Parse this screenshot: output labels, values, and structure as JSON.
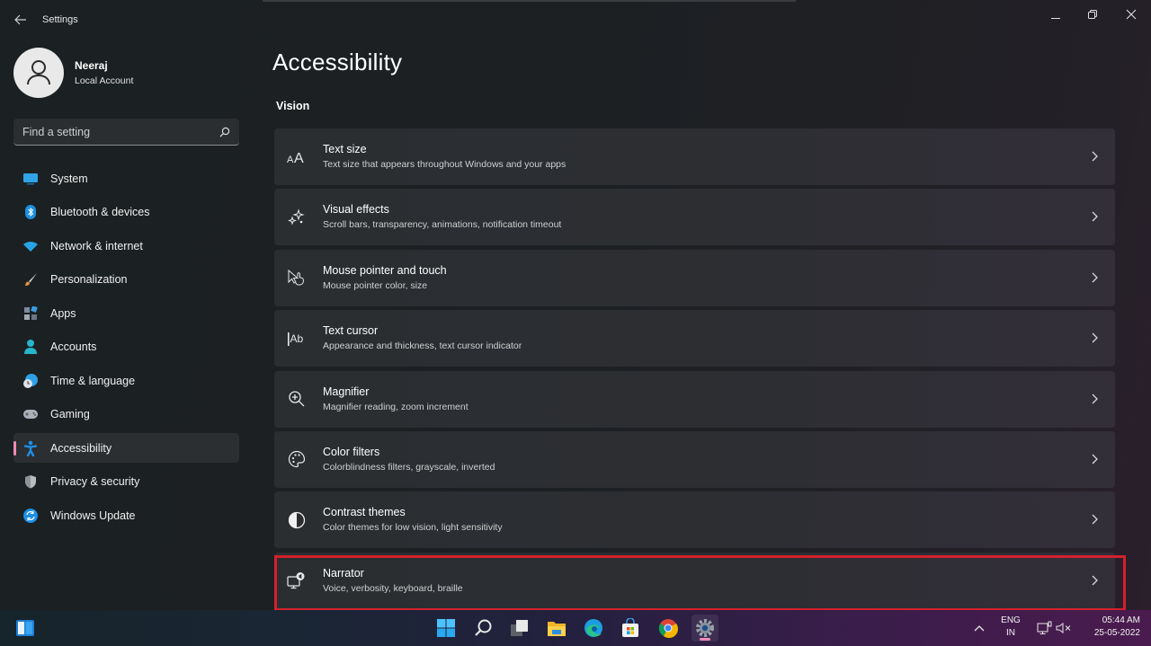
{
  "window": {
    "app_title": "Settings",
    "back_icon": "arrow-left-icon",
    "controls": {
      "minimize": "minimize-icon",
      "restore": "restore-icon",
      "close": "close-icon"
    }
  },
  "profile": {
    "name": "Neeraj",
    "account_type": "Local Account",
    "avatar_icon": "person-icon"
  },
  "search": {
    "placeholder": "Find a setting",
    "value": "",
    "icon": "search-icon"
  },
  "sidebar": {
    "active": "Accessibility",
    "items": [
      {
        "label": "System",
        "icon": "monitor-icon",
        "color": "#2fa4e7"
      },
      {
        "label": "Bluetooth & devices",
        "icon": "bluetooth-icon",
        "color": "#1b8fe0"
      },
      {
        "label": "Network & internet",
        "icon": "wifi-icon",
        "color": "#29a3e8"
      },
      {
        "label": "Personalization",
        "icon": "paintbrush-icon",
        "color": "#e8944a"
      },
      {
        "label": "Apps",
        "icon": "apps-icon",
        "color": "#8a9bb0"
      },
      {
        "label": "Accounts",
        "icon": "account-icon",
        "color": "#27b5c9"
      },
      {
        "label": "Time & language",
        "icon": "clock-globe-icon",
        "color": "#2f9fe6"
      },
      {
        "label": "Gaming",
        "icon": "gamepad-icon",
        "color": "#a9b0b8"
      },
      {
        "label": "Accessibility",
        "icon": "accessibility-icon",
        "color": "#1e8fe6"
      },
      {
        "label": "Privacy & security",
        "icon": "shield-icon",
        "color": "#b8bcc0"
      },
      {
        "label": "Windows Update",
        "icon": "update-icon",
        "color": "#1c8fe3"
      }
    ]
  },
  "main": {
    "title": "Accessibility",
    "section": "Vision",
    "cards": [
      {
        "title": "Text size",
        "subtitle": "Text size that appears throughout Windows and your apps",
        "icon": "text-size-icon"
      },
      {
        "title": "Visual effects",
        "subtitle": "Scroll bars, transparency, animations, notification timeout",
        "icon": "sparkle-icon"
      },
      {
        "title": "Mouse pointer and touch",
        "subtitle": "Mouse pointer color, size",
        "icon": "pointer-touch-icon"
      },
      {
        "title": "Text cursor",
        "subtitle": "Appearance and thickness, text cursor indicator",
        "icon": "text-cursor-icon"
      },
      {
        "title": "Magnifier",
        "subtitle": "Magnifier reading, zoom increment",
        "icon": "magnifier-icon"
      },
      {
        "title": "Color filters",
        "subtitle": "Colorblindness filters, grayscale, inverted",
        "icon": "palette-icon"
      },
      {
        "title": "Contrast themes",
        "subtitle": "Color themes for low vision, light sensitivity",
        "icon": "contrast-icon"
      },
      {
        "title": "Narrator",
        "subtitle": "Voice, verbosity, keyboard, braille",
        "icon": "narrator-icon"
      }
    ],
    "highlighted_card": "Narrator",
    "highlight_color": "#d3212c"
  },
  "taskbar": {
    "widgets_icon": "widgets-icon",
    "apps": [
      {
        "name": "Start",
        "icon": "windows-start-icon"
      },
      {
        "name": "Search",
        "icon": "search-icon"
      },
      {
        "name": "Task View",
        "icon": "task-view-icon"
      },
      {
        "name": "File Explorer",
        "icon": "folder-icon"
      },
      {
        "name": "Microsoft Edge",
        "icon": "edge-icon"
      },
      {
        "name": "Microsoft Store",
        "icon": "store-icon"
      },
      {
        "name": "Google Chrome",
        "icon": "chrome-icon"
      },
      {
        "name": "Settings",
        "icon": "settings-gear-icon",
        "active": true
      }
    ],
    "tray": {
      "overflow_icon": "chevron-up-icon",
      "lang_line1": "ENG",
      "lang_line2": "IN",
      "network_icon": "ethernet-icon",
      "volume_icon": "volume-muted-icon",
      "time": "05:44 AM",
      "date": "25-05-2022"
    }
  }
}
